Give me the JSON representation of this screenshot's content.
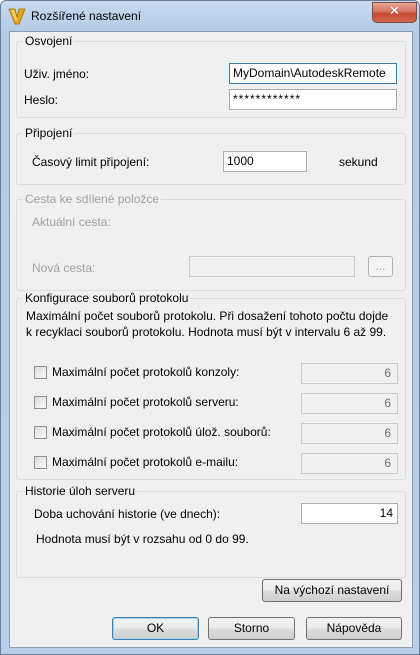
{
  "window": {
    "title": "Rozšířené nastavení",
    "close_glyph": "✕"
  },
  "auth": {
    "legend": "Osvojení",
    "username_label": "Uživ. jméno:",
    "username_value": "MyDomain\\AutodeskRemote",
    "password_label": "Heslo:",
    "password_value": "************"
  },
  "connection": {
    "legend": "Připojení",
    "timeout_label": "Časový limit připojení:",
    "timeout_value": "1000",
    "unit": "sekund"
  },
  "shared_path": {
    "legend": "Cesta ke sdílené položce",
    "current_label": "Aktuální cesta:",
    "new_label": "Nová cesta:",
    "browse_label": "..."
  },
  "logs": {
    "legend": "Konfigurace souborů protokolu",
    "description": "Maximální počet souborů protokolu. Při dosažení tohoto počtu dojde k recyklaci souborů protokolu. Hodnota musí být v intervalu 6 až 99.",
    "items": [
      {
        "label": "Maximální počet protokolů konzoly:",
        "value": "6"
      },
      {
        "label": "Maximální počet protokolů serveru:",
        "value": "6"
      },
      {
        "label": "Maximální počet protokolů úlož. souborů:",
        "value": "6"
      },
      {
        "label": "Maximální počet protokolů e-mailu:",
        "value": "6"
      }
    ]
  },
  "history": {
    "legend": "Historie úloh serveru",
    "retention_label": "Doba uchování historie (ve dnech):",
    "retention_value": "14",
    "hint": "Hodnota musí být v rozsahu od 0 do 99."
  },
  "buttons": {
    "defaults": "Na výchozí nastavení",
    "ok": "OK",
    "cancel": "Storno",
    "help": "Nápověda"
  }
}
